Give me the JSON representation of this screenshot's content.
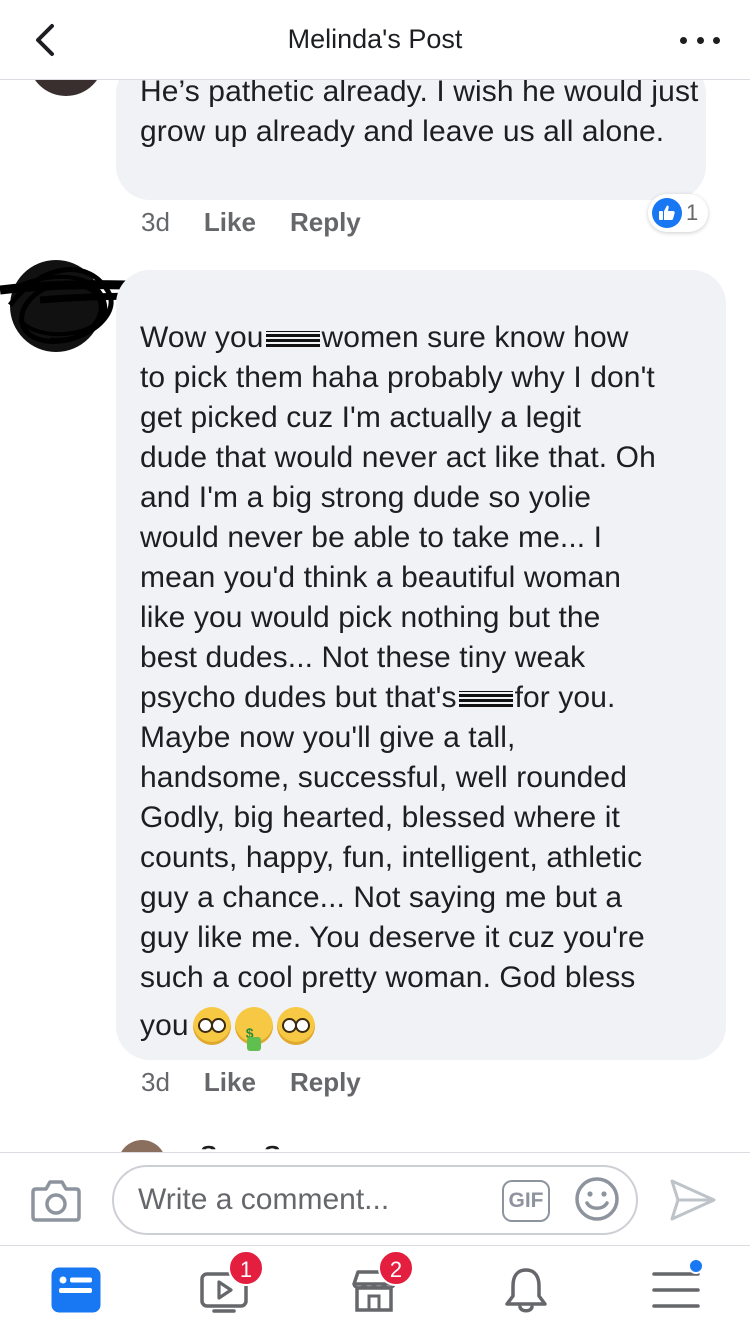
{
  "header": {
    "title": "Melinda's Post"
  },
  "comments": [
    {
      "text": "He’s pathetic already. I wish he would just grow up already and leave us all alone.",
      "time": "3d",
      "like_label": "Like",
      "reply_label": "Reply",
      "reaction_count": "1"
    },
    {
      "lines": [
        [
          "Wow you",
          "[redacted]",
          "women sure know how"
        ],
        "to pick them haha probably why I don't",
        "get picked cuz I'm actually a legit",
        "dude that would never act like that. Oh",
        "and I'm a big strong dude so yolie",
        "would never be able to take me... I",
        "mean you'd think a beautiful woman",
        "like you would pick nothing but the",
        "best dudes... Not these tiny weak",
        [
          "psycho dudes but that's",
          "[redacted]",
          "for you."
        ],
        "Maybe now you'll give a tall,",
        "handsome, successful, well rounded",
        "Godly, big hearted, blessed where it",
        "counts, happy, fun, intelligent, athletic",
        "guy a chance... Not saying me but a",
        "guy like me. You deserve it cuz you're",
        "such a cool pretty woman. God bless"
      ],
      "last_word": "you",
      "emojis": [
        "nerd-face",
        "money-mouth-face",
        "nerd-face"
      ],
      "time": "3d",
      "like_label": "Like",
      "reply_label": "Reply"
    }
  ],
  "next_comment": {
    "name": "Sara Severyn"
  },
  "composer": {
    "placeholder": "Write a comment...",
    "gif_label": "GIF"
  },
  "tabbar": {
    "tabs": [
      {
        "name": "news-feed",
        "icon": "news-feed-icon",
        "badge": ""
      },
      {
        "name": "watch",
        "icon": "video-icon",
        "badge": "1"
      },
      {
        "name": "marketplace",
        "icon": "marketplace-icon",
        "badge": "2"
      },
      {
        "name": "notifications",
        "icon": "bell-icon",
        "badge": ""
      },
      {
        "name": "menu",
        "icon": "menu-icon",
        "badge": ""
      }
    ],
    "accent_color": "#1877f2",
    "badge_color": "#e41e3f"
  }
}
